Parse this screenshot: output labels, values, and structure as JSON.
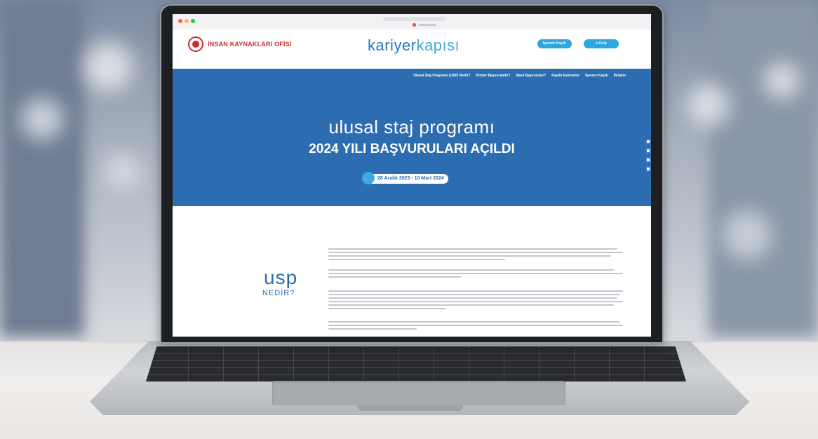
{
  "browser": {
    "url_text": "",
    "tab_title": ""
  },
  "header": {
    "office_name": "İNSAN KAYNAKLARI OFİSİ",
    "brand_part1": "kariyer",
    "brand_part2": "kapısı",
    "employer_button": "İşveren Kaydı",
    "login_button": "e-Giriş"
  },
  "nav": {
    "items": [
      "Ulusal Staj Programı (USP) Nedir?",
      "Kimler Başvurabilir?",
      "Nasıl Başvurulur?",
      "Kayıtlı İşverenler",
      "İşveren Kaydı",
      "İletişim"
    ]
  },
  "hero": {
    "title": "ulusal staj programı",
    "subtitle": "2024 YILI BAŞVURULARI AÇILDI",
    "date_range": "28 Aralık 2023 - 10 Mart 2024"
  },
  "section": {
    "heading_big": "usp",
    "heading_small": "NEDİR?"
  },
  "colors": {
    "brand_blue": "#2c6db2",
    "accent_cyan": "#2ea6e0",
    "office_red": "#c9302c"
  }
}
